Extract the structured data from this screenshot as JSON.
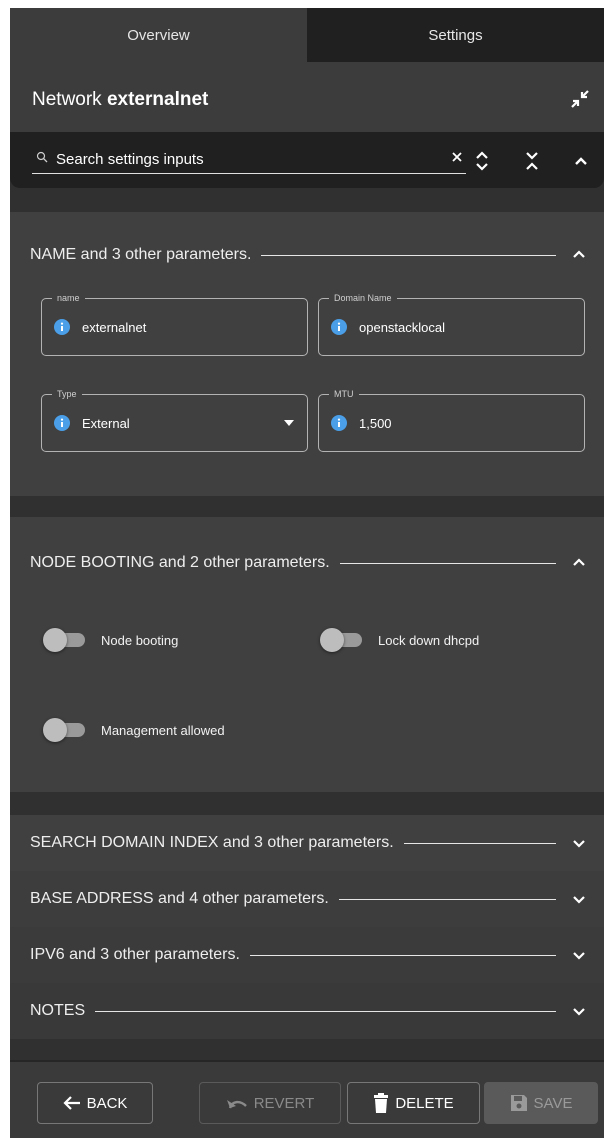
{
  "tabs": [
    {
      "label": "Overview"
    },
    {
      "label": "Settings"
    }
  ],
  "header": {
    "title_prefix": "Network",
    "title_name": "externalnet"
  },
  "search": {
    "placeholder": "Search settings inputs"
  },
  "sections": [
    {
      "title": "NAME and 3 other parameters.",
      "expanded": true,
      "fields": [
        {
          "label": "name",
          "value": "externalnet",
          "icon": "info-icon"
        },
        {
          "label": "Domain Name",
          "value": "openstacklocal",
          "icon": "info-icon"
        },
        {
          "label": "Type",
          "value": "External",
          "icon": "info-icon",
          "dropdown": true
        },
        {
          "label": "MTU",
          "value": "1,500",
          "icon": "info-icon"
        }
      ]
    },
    {
      "title": "NODE BOOTING and 2 other parameters.",
      "expanded": true,
      "toggles": [
        {
          "label": "Node booting",
          "on": false
        },
        {
          "label": "Lock down dhcpd",
          "on": false
        },
        {
          "label": "Management allowed",
          "on": false
        }
      ]
    },
    {
      "title": "SEARCH DOMAIN INDEX and 3 other parameters.",
      "expanded": false
    },
    {
      "title": "BASE ADDRESS and 4 other parameters.",
      "expanded": false
    },
    {
      "title": "IPV6 and 3 other parameters.",
      "expanded": false
    },
    {
      "title": "NOTES",
      "expanded": false
    }
  ],
  "footer": {
    "back": "BACK",
    "revert": "REVERT",
    "delete": "DELETE",
    "save": "SAVE"
  },
  "colors": {
    "info_icon": "#4a9fe8",
    "panel_bg": "#303030",
    "card_bg": "#404040",
    "active_tab_bg": "#202020"
  }
}
